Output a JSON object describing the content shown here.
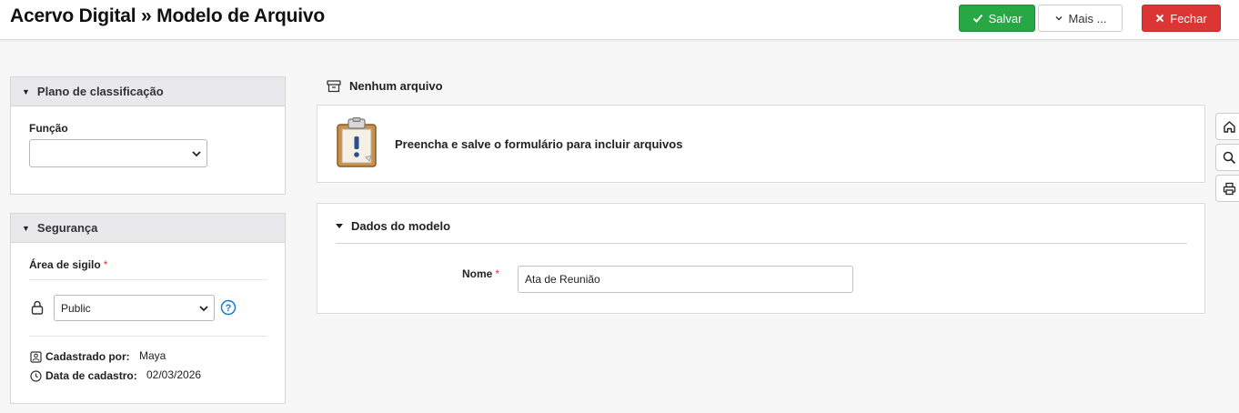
{
  "header": {
    "title": "Acervo Digital » Modelo de Arquivo",
    "save_label": "Salvar",
    "more_label": "Mais ...",
    "close_label": "Fechar"
  },
  "classification": {
    "title": "Plano de classificação",
    "funcao_label": "Função",
    "funcao_value": ""
  },
  "security": {
    "title": "Segurança",
    "area_label": "Área de sigilo",
    "required_mark": "*",
    "area_value": "Public",
    "created_by_label": "Cadastrado por:",
    "created_by_value": "Maya",
    "created_date_label": "Data de cadastro:",
    "created_date_value": "02/03/2026"
  },
  "files": {
    "title": "Nenhum arquivo",
    "message": "Preencha e salve o formulário para incluir arquivos"
  },
  "model": {
    "title": "Dados do modelo",
    "name_label": "Nome",
    "required_mark": "*",
    "name_value": "Ata de Reunião"
  },
  "colors": {
    "save": "#28a745",
    "close": "#dc3535",
    "help": "#1a7ad4"
  }
}
